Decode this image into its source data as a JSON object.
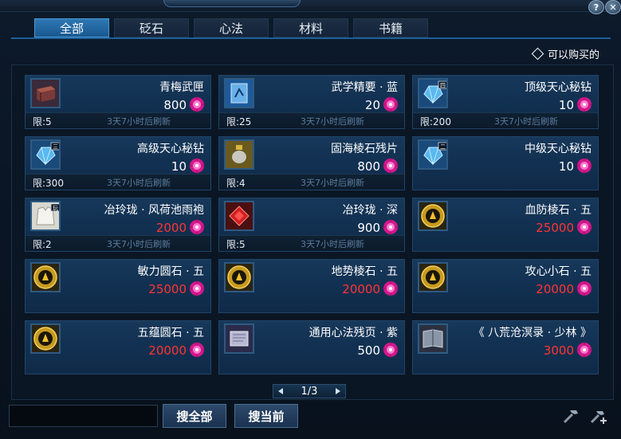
{
  "window": {
    "help_glyph": "?",
    "close_glyph": "✕"
  },
  "tabs": [
    {
      "label": "全部",
      "active": true
    },
    {
      "label": "砭石",
      "active": false
    },
    {
      "label": "心法",
      "active": false
    },
    {
      "label": "材料",
      "active": false
    },
    {
      "label": "书籍",
      "active": false
    }
  ],
  "filter": {
    "label": "可以购买的",
    "checked": false
  },
  "items": [
    {
      "name": "青梅武匣",
      "price": "800",
      "price_color": "white",
      "limit": "限:5",
      "refresh": "3天7小时后刷新",
      "icon": "chest-icon"
    },
    {
      "name": "武学精要 · 蓝",
      "price": "20",
      "price_color": "white",
      "limit": "限:25",
      "refresh": "3天7小时后刷新",
      "icon": "blue-scroll-icon"
    },
    {
      "name": "顶级天心秘钻",
      "price": "10",
      "price_color": "white",
      "limit": "限:200",
      "refresh": "3天7小时后刷新",
      "icon": "diamond-crystal-icon",
      "tier": "四"
    },
    {
      "name": "高级天心秘钻",
      "price": "10",
      "price_color": "white",
      "limit": "限:300",
      "refresh": "3天7小时后刷新",
      "icon": "diamond-crystal-icon",
      "tier": "三"
    },
    {
      "name": "固海棱石残片",
      "price": "800",
      "price_color": "white",
      "limit": "限:4",
      "refresh": "3天7小时后刷新",
      "icon": "stone-fragment-icon"
    },
    {
      "name": "中级天心秘钻",
      "price": "10",
      "price_color": "white",
      "limit": "",
      "refresh": "",
      "icon": "diamond-crystal-icon",
      "tier": "二"
    },
    {
      "name": "冶玲珑 · 风荷池雨袍",
      "price": "2000",
      "price_color": "red",
      "limit": "限:2",
      "refresh": "3天7小时后刷新",
      "icon": "robe-icon",
      "tier": "玩"
    },
    {
      "name": "冶玲珑 · 深",
      "price": "900",
      "price_color": "white",
      "limit": "限:5",
      "refresh": "3天7小时后刷新",
      "icon": "red-gem-icon"
    },
    {
      "name": "血防棱石 · 五",
      "price": "25000",
      "price_color": "red",
      "limit": "",
      "refresh": "",
      "icon": "gold-stone-icon"
    },
    {
      "name": "敏力圆石 · 五",
      "price": "25000",
      "price_color": "red",
      "limit": "",
      "refresh": "",
      "icon": "gold-stone-icon"
    },
    {
      "name": "地势棱石 · 五",
      "price": "20000",
      "price_color": "red",
      "limit": "",
      "refresh": "",
      "icon": "gold-stone-icon"
    },
    {
      "name": "攻心小石 · 五",
      "price": "20000",
      "price_color": "red",
      "limit": "",
      "refresh": "",
      "icon": "gold-stone-icon"
    },
    {
      "name": "五蕴圆石 · 五",
      "price": "20000",
      "price_color": "red",
      "limit": "",
      "refresh": "",
      "icon": "gold-stone-icon"
    },
    {
      "name": "通用心法残页 · 紫",
      "price": "500",
      "price_color": "white",
      "limit": "",
      "refresh": "",
      "icon": "purple-scroll-icon"
    },
    {
      "name": "《 八荒沧溟录 · 少林 》",
      "price": "3000",
      "price_color": "red",
      "limit": "",
      "refresh": "",
      "icon": "book-icon"
    }
  ],
  "pager": {
    "text": "1/3"
  },
  "search": {
    "value": "",
    "placeholder": ""
  },
  "buttons": {
    "search_all": "搜全部",
    "search_current": "搜当前"
  },
  "colors": {
    "accent": "#2e78b4",
    "price_red": "#ff3434",
    "currency": "#d4188c"
  }
}
